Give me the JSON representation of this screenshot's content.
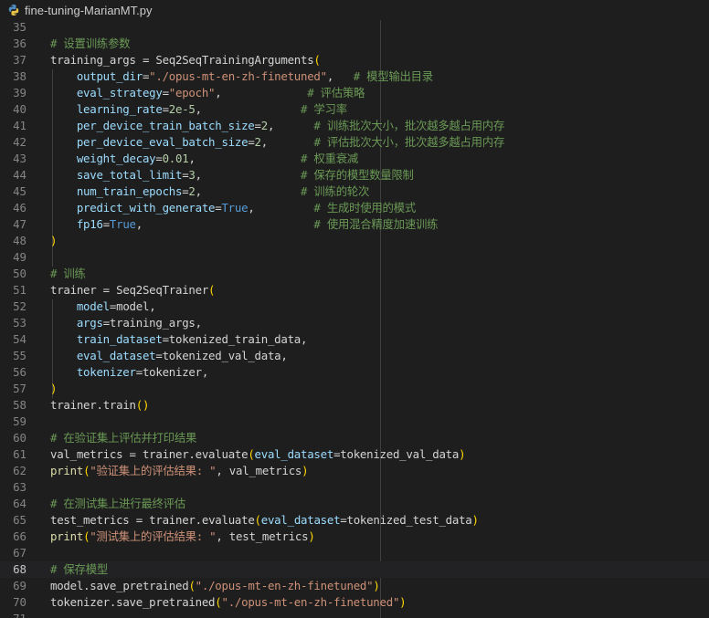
{
  "tab": {
    "title": "fine-tuning-MarianMT.py",
    "icon": "python-file-icon"
  },
  "editor": {
    "current_line": 68,
    "lines": [
      {
        "n": "35",
        "t": []
      },
      {
        "n": "36",
        "t": [
          [
            "# 设置训练参数",
            "c"
          ]
        ]
      },
      {
        "n": "37",
        "t": [
          [
            "training_args",
            "d"
          ],
          [
            " = ",
            "d"
          ],
          [
            "Seq2SeqTrainingArguments",
            "d"
          ],
          [
            "(",
            "b"
          ]
        ]
      },
      {
        "n": "38",
        "t": [
          [
            "    ",
            "d"
          ],
          [
            "output_dir",
            "v"
          ],
          [
            "=",
            "d"
          ],
          [
            "\"./opus-mt-en-zh-finetuned\"",
            "s"
          ],
          [
            ",   ",
            "d"
          ],
          [
            "# 模型输出目录",
            "c"
          ]
        ]
      },
      {
        "n": "39",
        "t": [
          [
            "    ",
            "d"
          ],
          [
            "eval_strategy",
            "v"
          ],
          [
            "=",
            "d"
          ],
          [
            "\"epoch\"",
            "s"
          ],
          [
            ",             ",
            "d"
          ],
          [
            "# 评估策略",
            "c"
          ]
        ]
      },
      {
        "n": "40",
        "t": [
          [
            "    ",
            "d"
          ],
          [
            "learning_rate",
            "v"
          ],
          [
            "=",
            "d"
          ],
          [
            "2e-5",
            "n"
          ],
          [
            ",               ",
            "d"
          ],
          [
            "# 学习率",
            "c"
          ]
        ]
      },
      {
        "n": "41",
        "t": [
          [
            "    ",
            "d"
          ],
          [
            "per_device_train_batch_size",
            "v"
          ],
          [
            "=",
            "d"
          ],
          [
            "2",
            "n"
          ],
          [
            ",      ",
            "d"
          ],
          [
            "# 训练批次大小，批次越多越占用内存",
            "c"
          ]
        ]
      },
      {
        "n": "42",
        "t": [
          [
            "    ",
            "d"
          ],
          [
            "per_device_eval_batch_size",
            "v"
          ],
          [
            "=",
            "d"
          ],
          [
            "2",
            "n"
          ],
          [
            ",       ",
            "d"
          ],
          [
            "# 评估批次大小，批次越多越占用内存",
            "c"
          ]
        ]
      },
      {
        "n": "43",
        "t": [
          [
            "    ",
            "d"
          ],
          [
            "weight_decay",
            "v"
          ],
          [
            "=",
            "d"
          ],
          [
            "0.01",
            "n"
          ],
          [
            ",                ",
            "d"
          ],
          [
            "# 权重衰减",
            "c"
          ]
        ]
      },
      {
        "n": "44",
        "t": [
          [
            "    ",
            "d"
          ],
          [
            "save_total_limit",
            "v"
          ],
          [
            "=",
            "d"
          ],
          [
            "3",
            "n"
          ],
          [
            ",               ",
            "d"
          ],
          [
            "# 保存的模型数量限制",
            "c"
          ]
        ]
      },
      {
        "n": "45",
        "t": [
          [
            "    ",
            "d"
          ],
          [
            "num_train_epochs",
            "v"
          ],
          [
            "=",
            "d"
          ],
          [
            "2",
            "n"
          ],
          [
            ",               ",
            "d"
          ],
          [
            "# 训练的轮次",
            "c"
          ]
        ]
      },
      {
        "n": "46",
        "t": [
          [
            "    ",
            "d"
          ],
          [
            "predict_with_generate",
            "v"
          ],
          [
            "=",
            "d"
          ],
          [
            "True",
            "k"
          ],
          [
            ",         ",
            "d"
          ],
          [
            "# 生成时使用的模式",
            "c"
          ]
        ]
      },
      {
        "n": "47",
        "t": [
          [
            "    ",
            "d"
          ],
          [
            "fp16",
            "v"
          ],
          [
            "=",
            "d"
          ],
          [
            "True",
            "k"
          ],
          [
            ",                          ",
            "d"
          ],
          [
            "# 使用混合精度加速训练",
            "c"
          ]
        ]
      },
      {
        "n": "48",
        "t": [
          [
            ")",
            "b"
          ]
        ]
      },
      {
        "n": "49",
        "t": []
      },
      {
        "n": "50",
        "t": [
          [
            "# 训练",
            "c"
          ]
        ]
      },
      {
        "n": "51",
        "t": [
          [
            "trainer",
            "d"
          ],
          [
            " = ",
            "d"
          ],
          [
            "Seq2SeqTrainer",
            "d"
          ],
          [
            "(",
            "b"
          ]
        ]
      },
      {
        "n": "52",
        "t": [
          [
            "    ",
            "d"
          ],
          [
            "model",
            "v"
          ],
          [
            "=",
            "d"
          ],
          [
            "model",
            "d"
          ],
          [
            ",",
            "d"
          ]
        ]
      },
      {
        "n": "53",
        "t": [
          [
            "    ",
            "d"
          ],
          [
            "args",
            "v"
          ],
          [
            "=",
            "d"
          ],
          [
            "training_args",
            "d"
          ],
          [
            ",",
            "d"
          ]
        ]
      },
      {
        "n": "54",
        "t": [
          [
            "    ",
            "d"
          ],
          [
            "train_dataset",
            "v"
          ],
          [
            "=",
            "d"
          ],
          [
            "tokenized_train_data",
            "d"
          ],
          [
            ",",
            "d"
          ]
        ]
      },
      {
        "n": "55",
        "t": [
          [
            "    ",
            "d"
          ],
          [
            "eval_dataset",
            "v"
          ],
          [
            "=",
            "d"
          ],
          [
            "tokenized_val_data",
            "d"
          ],
          [
            ",",
            "d"
          ]
        ]
      },
      {
        "n": "56",
        "t": [
          [
            "    ",
            "d"
          ],
          [
            "tokenizer",
            "v"
          ],
          [
            "=",
            "d"
          ],
          [
            "tokenizer",
            "d"
          ],
          [
            ",",
            "d"
          ]
        ]
      },
      {
        "n": "57",
        "t": [
          [
            ")",
            "b"
          ]
        ]
      },
      {
        "n": "58",
        "t": [
          [
            "trainer",
            "d"
          ],
          [
            ".",
            "d"
          ],
          [
            "train",
            "d"
          ],
          [
            "()",
            "b"
          ]
        ]
      },
      {
        "n": "59",
        "t": []
      },
      {
        "n": "60",
        "t": [
          [
            "# 在验证集上评估并打印结果",
            "c"
          ]
        ]
      },
      {
        "n": "61",
        "t": [
          [
            "val_metrics",
            "d"
          ],
          [
            " = ",
            "d"
          ],
          [
            "trainer",
            "d"
          ],
          [
            ".",
            "d"
          ],
          [
            "evaluate",
            "d"
          ],
          [
            "(",
            "b"
          ],
          [
            "eval_dataset",
            "v"
          ],
          [
            "=",
            "d"
          ],
          [
            "tokenized_val_data",
            "d"
          ],
          [
            ")",
            "b"
          ]
        ]
      },
      {
        "n": "62",
        "t": [
          [
            "print",
            "f"
          ],
          [
            "(",
            "b"
          ],
          [
            "\"验证集上的评估结果: \"",
            "s"
          ],
          [
            ", val_metrics",
            "d"
          ],
          [
            ")",
            "b"
          ]
        ]
      },
      {
        "n": "63",
        "t": []
      },
      {
        "n": "64",
        "t": [
          [
            "# 在测试集上进行最终评估",
            "c"
          ]
        ]
      },
      {
        "n": "65",
        "t": [
          [
            "test_metrics",
            "d"
          ],
          [
            " = ",
            "d"
          ],
          [
            "trainer",
            "d"
          ],
          [
            ".",
            "d"
          ],
          [
            "evaluate",
            "d"
          ],
          [
            "(",
            "b"
          ],
          [
            "eval_dataset",
            "v"
          ],
          [
            "=",
            "d"
          ],
          [
            "tokenized_test_data",
            "d"
          ],
          [
            ")",
            "b"
          ]
        ]
      },
      {
        "n": "66",
        "t": [
          [
            "print",
            "f"
          ],
          [
            "(",
            "b"
          ],
          [
            "\"测试集上的评估结果: \"",
            "s"
          ],
          [
            ", test_metrics",
            "d"
          ],
          [
            ")",
            "b"
          ]
        ]
      },
      {
        "n": "67",
        "t": []
      },
      {
        "n": "68",
        "t": [
          [
            "# 保存模型",
            "c"
          ]
        ]
      },
      {
        "n": "69",
        "t": [
          [
            "model",
            "d"
          ],
          [
            ".",
            "d"
          ],
          [
            "save_pretrained",
            "d"
          ],
          [
            "(",
            "b"
          ],
          [
            "\"./opus-mt-en-zh-finetuned\"",
            "s"
          ],
          [
            ")",
            "b"
          ]
        ]
      },
      {
        "n": "70",
        "t": [
          [
            "tokenizer",
            "d"
          ],
          [
            ".",
            "d"
          ],
          [
            "save_pretrained",
            "d"
          ],
          [
            "(",
            "b"
          ],
          [
            "\"./opus-mt-en-zh-finetuned\"",
            "s"
          ],
          [
            ")",
            "b"
          ]
        ]
      },
      {
        "n": "71",
        "t": []
      }
    ]
  },
  "colors": {
    "background": "#1e1e1e",
    "comment": "#6a9955",
    "string": "#ce9178",
    "number": "#b5cea8",
    "keyword": "#569cd6",
    "parameter": "#9cdcfe",
    "function": "#dcdcaa",
    "bracket": "#ffd700"
  }
}
